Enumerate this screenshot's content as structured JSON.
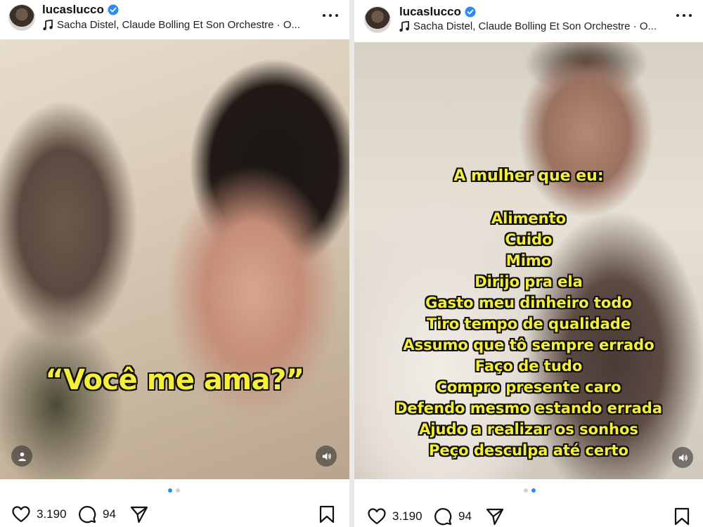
{
  "posts": [
    {
      "username": "lucaslucco",
      "audio": "Sacha Distel, Claude Bolling Et Son Orchestre · O...",
      "caption": "“Você me ama?”",
      "likes": "3.190",
      "comments": "94",
      "carousel": {
        "total": 2,
        "current": 1
      }
    },
    {
      "username": "lucaslucco",
      "audio": "Sacha Distel, Claude Bolling Et Son Orchestre · O...",
      "title": "A mulher que eu:",
      "lines": [
        "Alimento",
        "Cuido",
        "Mimo",
        "Dirijo pra ela",
        "Gasto meu dinheiro todo",
        "Tiro tempo de qualidade",
        "Assumo que tô sempre errado",
        "Faço de tudo",
        "Compro presente caro",
        "Defendo mesmo estando errada",
        "Ajudo a realizar os sonhos",
        "Peço desculpa até certo"
      ],
      "likes": "3.190",
      "comments": "94",
      "carousel": {
        "total": 2,
        "current": 2
      }
    }
  ],
  "icons": {
    "verified": "verified-badge-icon",
    "audio": "music-note-icon",
    "more": "more-options-icon",
    "like": "heart-icon",
    "comment": "comment-bubble-icon",
    "share": "send-plane-icon",
    "save": "bookmark-icon",
    "mute": "speaker-icon",
    "tags": "user-tag-icon"
  },
  "colors": {
    "accent": "#2a8bf2",
    "caption_text": "#f5ef3a",
    "caption_outline": "#111111"
  }
}
